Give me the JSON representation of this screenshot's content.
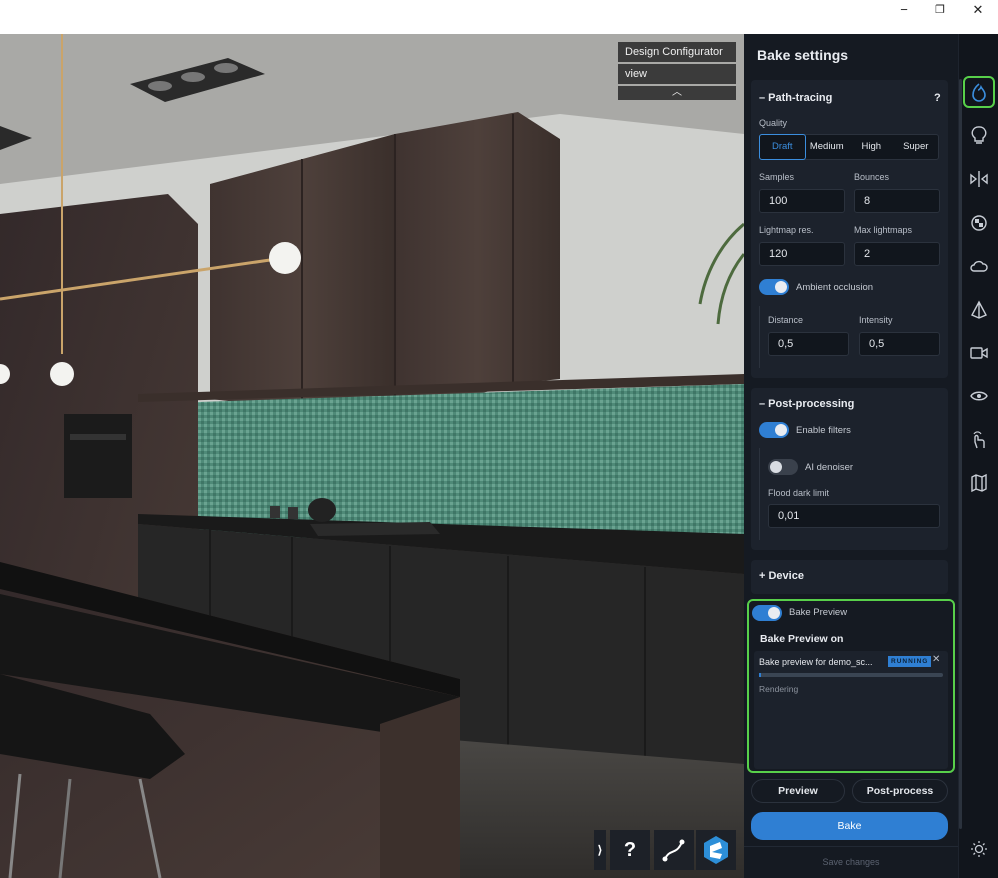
{
  "window": {
    "minimize": "−",
    "restore": "❐",
    "close": "✕"
  },
  "overlay": {
    "title": "Design Configurator",
    "view": "view",
    "collapse": "︿"
  },
  "viewport_toolbar": {
    "expand": "⟩",
    "help": "?"
  },
  "panel": {
    "title": "Bake settings",
    "path_tracing": {
      "header": "– Path-tracing",
      "help": "?",
      "quality_label": "Quality",
      "quality_options": [
        "Draft",
        "Medium",
        "High",
        "Super"
      ],
      "samples_label": "Samples",
      "samples": "100",
      "bounces_label": "Bounces",
      "bounces": "8",
      "lightmap_label": "Lightmap res.",
      "lightmap": "120",
      "maxlm_label": "Max lightmaps",
      "maxlm": "2",
      "ao_label": "Ambient occlusion",
      "distance_label": "Distance",
      "distance": "0,5",
      "intensity_label": "Intensity",
      "intensity": "0,5"
    },
    "post": {
      "header": "– Post-processing",
      "filters_label": "Enable filters",
      "denoiser_label": "AI denoiser",
      "flood_label": "Flood dark limit",
      "flood": "0,01"
    },
    "device": {
      "header": "+ Device"
    },
    "bake_preview": {
      "toggle_label": "Bake Preview",
      "title": "Bake Preview on",
      "job": "Bake preview for demo_sc...",
      "status": "RUNNING",
      "close": "✕",
      "state": "Rendering",
      "progress": 0.01
    },
    "buttons": {
      "preview": "Preview",
      "post_process": "Post-process",
      "bake": "Bake",
      "save": "Save changes"
    }
  },
  "colors": {
    "accent": "#3b8ede",
    "highlight": "#58d04a",
    "toggle_on": "#2f7fd3",
    "panel_bg": "#151a22"
  }
}
